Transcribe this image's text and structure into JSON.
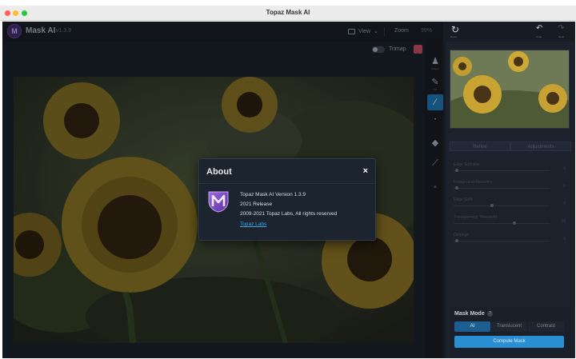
{
  "window": {
    "title": "Topaz Mask AI"
  },
  "header": {
    "app_name": "Mask AI",
    "version": "v1.3.9",
    "view_label": "View",
    "zoom_label": "Zoom",
    "zoom_value": "99%"
  },
  "trimap": {
    "label": "Trimap"
  },
  "toolstrip": {
    "items": [
      {
        "icon": "subject-icon",
        "caption": "Subject"
      },
      {
        "icon": "eraser-icon",
        "caption": "Fill"
      },
      {
        "icon": "brush-icon",
        "caption": ""
      },
      {
        "icon": "paint-bucket-icon",
        "caption": ""
      },
      {
        "icon": "picker-icon",
        "caption": ""
      },
      {
        "icon": "trash-icon",
        "caption": ""
      }
    ]
  },
  "right_panel": {
    "reset_caption": "Reset",
    "undo_caption": "Undo",
    "redo_caption": "Redo",
    "tabs": [
      "Refine",
      "Adjustments"
    ],
    "sliders": [
      {
        "label": "Edge Softness",
        "value": "0"
      },
      {
        "label": "Foreground Recovery",
        "value": "0"
      },
      {
        "label": "Edge Shift",
        "value": "0"
      },
      {
        "label": "Transparency Threshold",
        "value": "50"
      },
      {
        "label": "Defringe",
        "value": "0"
      }
    ]
  },
  "mask_mode": {
    "title": "Mask Mode",
    "help": "?",
    "options": [
      "AI",
      "Translucent",
      "Contrast"
    ],
    "selected": "AI",
    "compute_label": "Compute Mask"
  },
  "about": {
    "title": "About",
    "close": "×",
    "lines": [
      "Topaz Mask AI Version 1.3.9",
      "2021 Release",
      "2009-2021 Topaz Labs, All rights reserved"
    ],
    "link": "Topaz Labs"
  },
  "colors": {
    "accent": "#2a8fd2",
    "brand": "#7b4fc7"
  }
}
